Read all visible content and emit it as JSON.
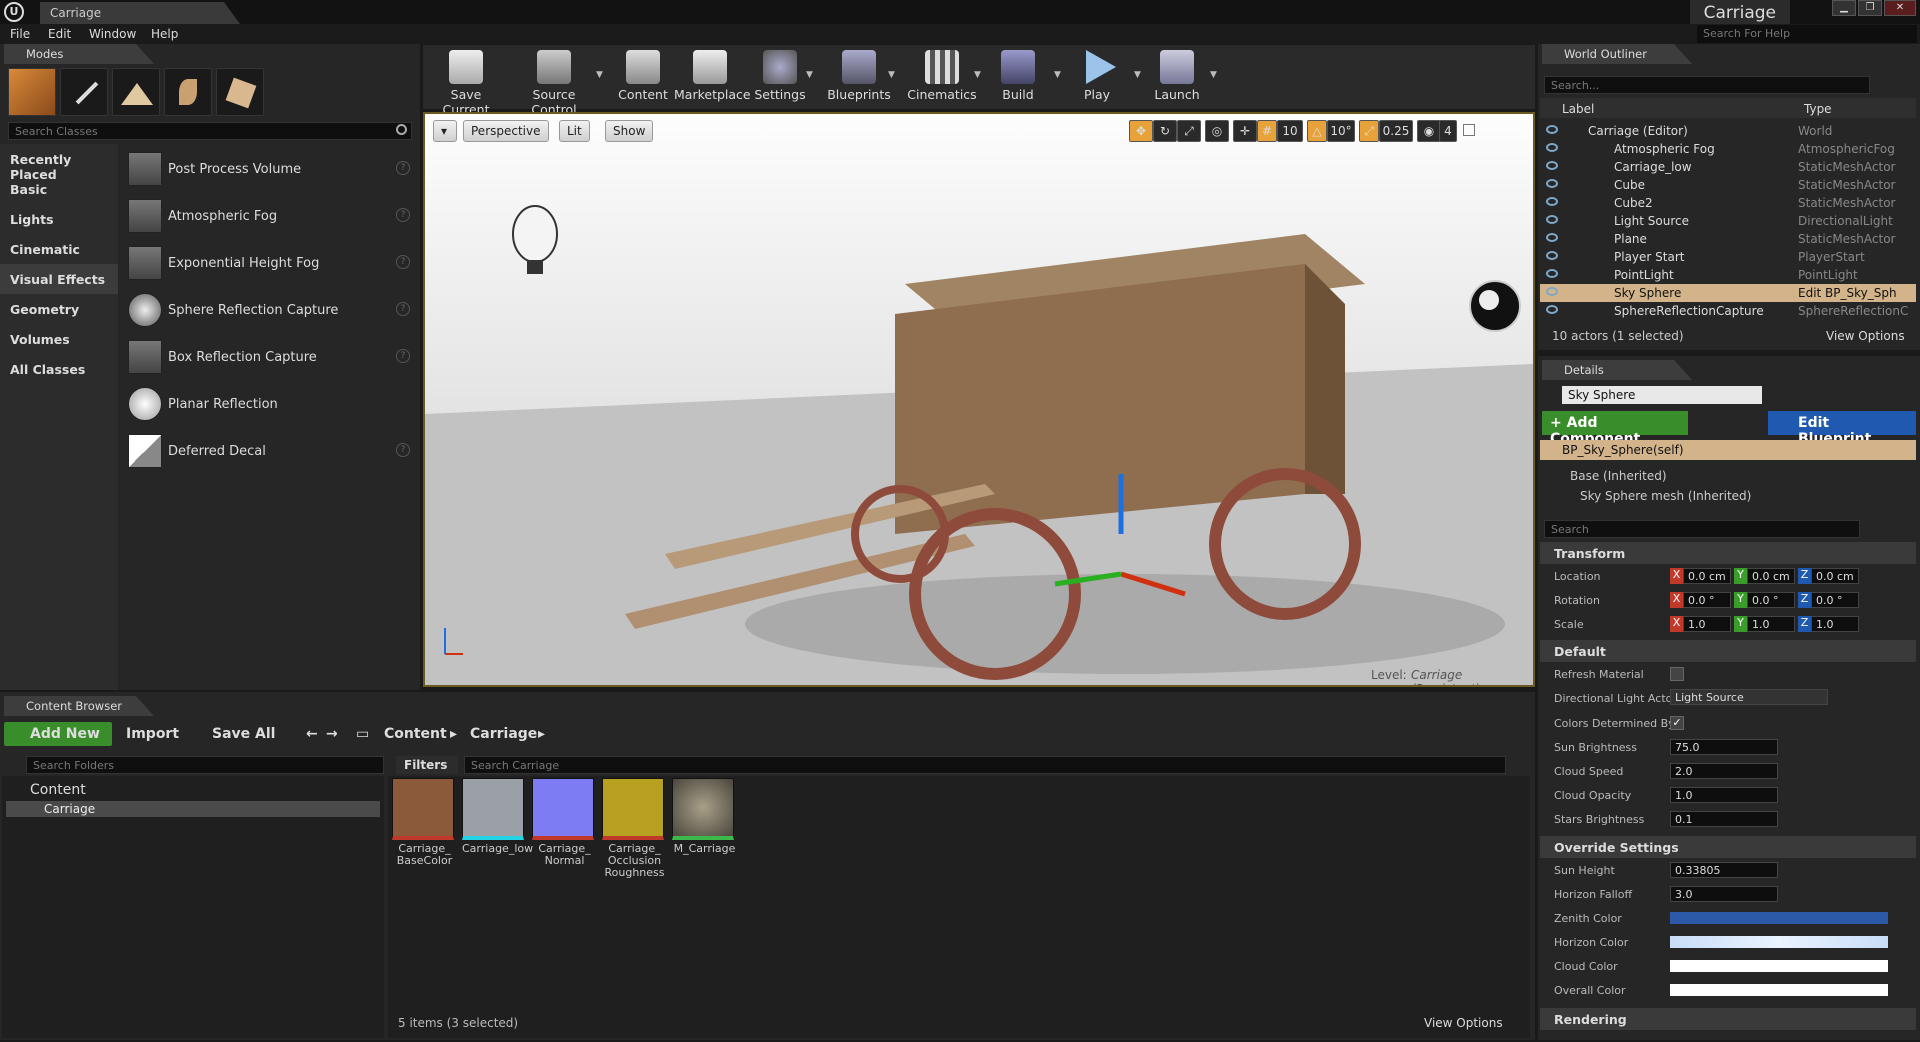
{
  "window": {
    "tab_title": "Carriage",
    "project_name": "Carriage",
    "help_search_placeholder": "Search For Help",
    "minimize": "▁",
    "restore": "❐",
    "close": "✕"
  },
  "menu": [
    "File",
    "Edit",
    "Window",
    "Help"
  ],
  "modes": {
    "tab": "Modes",
    "search_placeholder": "Search Classes",
    "categories": [
      "Recently Placed",
      "Basic",
      "Lights",
      "Cinematic",
      "Visual Effects",
      "Geometry",
      "Volumes",
      "All Classes"
    ],
    "selected_category": "Visual Effects",
    "items": [
      "Post Process Volume",
      "Atmospheric Fog",
      "Exponential Height Fog",
      "Sphere Reflection Capture",
      "Box Reflection Capture",
      "Planar Reflection",
      "Deferred Decal"
    ]
  },
  "toolbar": [
    "Save Current",
    "Source Control",
    "Content",
    "Marketplace",
    "Settings",
    "Blueprints",
    "Cinematics",
    "Build",
    "Play",
    "Launch"
  ],
  "viewport": {
    "perspective": "Perspective",
    "lit": "Lit",
    "show": "Show",
    "grid_snap": "10",
    "rot_snap": "10°",
    "scale_snap": "0.25",
    "cam_speed": "4",
    "level_label": "Level:",
    "level_name": "Carriage (Persistent)"
  },
  "content_browser": {
    "tab": "Content Browser",
    "add_new": "Add New",
    "import": "Import",
    "save_all": "Save All",
    "path": [
      "Content",
      "Carriage"
    ],
    "search_folders": "Search Folders",
    "filters": "Filters",
    "search_assets": "Search Carriage",
    "tree": [
      "Content",
      "Carriage"
    ],
    "assets": [
      {
        "name": "Carriage_ BaseColor",
        "color": "#8a5a3a",
        "bar": "#c0392b"
      },
      {
        "name": "Carriage_low",
        "color": "#9aa0a6",
        "bar": "#22d3e6"
      },
      {
        "name": "Carriage_ Normal",
        "color": "#7d7cf2",
        "bar": "#c0392b"
      },
      {
        "name": "Carriage_ Occlusion Roughness",
        "color": "#b8a020",
        "bar": "#c0392b"
      },
      {
        "name": "M_Carriage",
        "color": "#6d6a60",
        "bar": "#3db84a"
      }
    ],
    "status": "5 items (3 selected)",
    "view_options": "View Options"
  },
  "outliner": {
    "tab": "World Outliner",
    "search_placeholder": "Search...",
    "col_label": "Label",
    "col_type": "Type",
    "rows": [
      {
        "label": "Carriage (Editor)",
        "type": "World"
      },
      {
        "label": "Atmospheric Fog",
        "type": "AtmosphericFog"
      },
      {
        "label": "Carriage_low",
        "type": "StaticMeshActor"
      },
      {
        "label": "Cube",
        "type": "StaticMeshActor"
      },
      {
        "label": "Cube2",
        "type": "StaticMeshActor"
      },
      {
        "label": "Light Source",
        "type": "DirectionalLight"
      },
      {
        "label": "Plane",
        "type": "StaticMeshActor"
      },
      {
        "label": "Player Start",
        "type": "PlayerStart"
      },
      {
        "label": "PointLight",
        "type": "PointLight"
      },
      {
        "label": "Sky Sphere",
        "type": "Edit BP_Sky_Sph"
      },
      {
        "label": "SphereReflectionCapture",
        "type": "SphereReflectionC"
      }
    ],
    "status": "10 actors (1 selected)",
    "view_options": "View Options"
  },
  "details": {
    "tab": "Details",
    "name": "Sky Sphere",
    "add_component": "+ Add Component",
    "edit_blueprint": "Edit Blueprint",
    "self": "BP_Sky_Sphere(self)",
    "base": "Base (Inherited)",
    "mesh": "Sky Sphere mesh (Inherited)",
    "search_placeholder": "Search",
    "transform": "Transform",
    "location": "Location",
    "rotation": "Rotation",
    "scale": "Scale",
    "loc": [
      "0.0 cm",
      "0.0 cm",
      "0.0 cm"
    ],
    "rot": [
      "0.0 °",
      "0.0 °",
      "0.0 °"
    ],
    "scl": [
      "1.0",
      "1.0",
      "1.0"
    ],
    "default": "Default",
    "refresh": "Refresh Material",
    "dir_light": "Directional Light Acto",
    "dir_light_val": "Light Source",
    "colors_det": "Colors Determined By",
    "sun_bright": "Sun Brightness",
    "sun_bright_v": "75.0",
    "cloud_speed": "Cloud Speed",
    "cloud_speed_v": "2.0",
    "cloud_op": "Cloud Opacity",
    "cloud_op_v": "1.0",
    "stars": "Stars Brightness",
    "stars_v": "0.1",
    "override": "Override Settings",
    "sun_h": "Sun Height",
    "sun_h_v": "0.33805",
    "horizon_f": "Horizon Falloff",
    "horizon_f_v": "3.0",
    "zenith": "Zenith Color",
    "horizon_c": "Horizon Color",
    "cloud_c": "Cloud Color",
    "overall": "Overall Color",
    "rendering": "Rendering"
  }
}
